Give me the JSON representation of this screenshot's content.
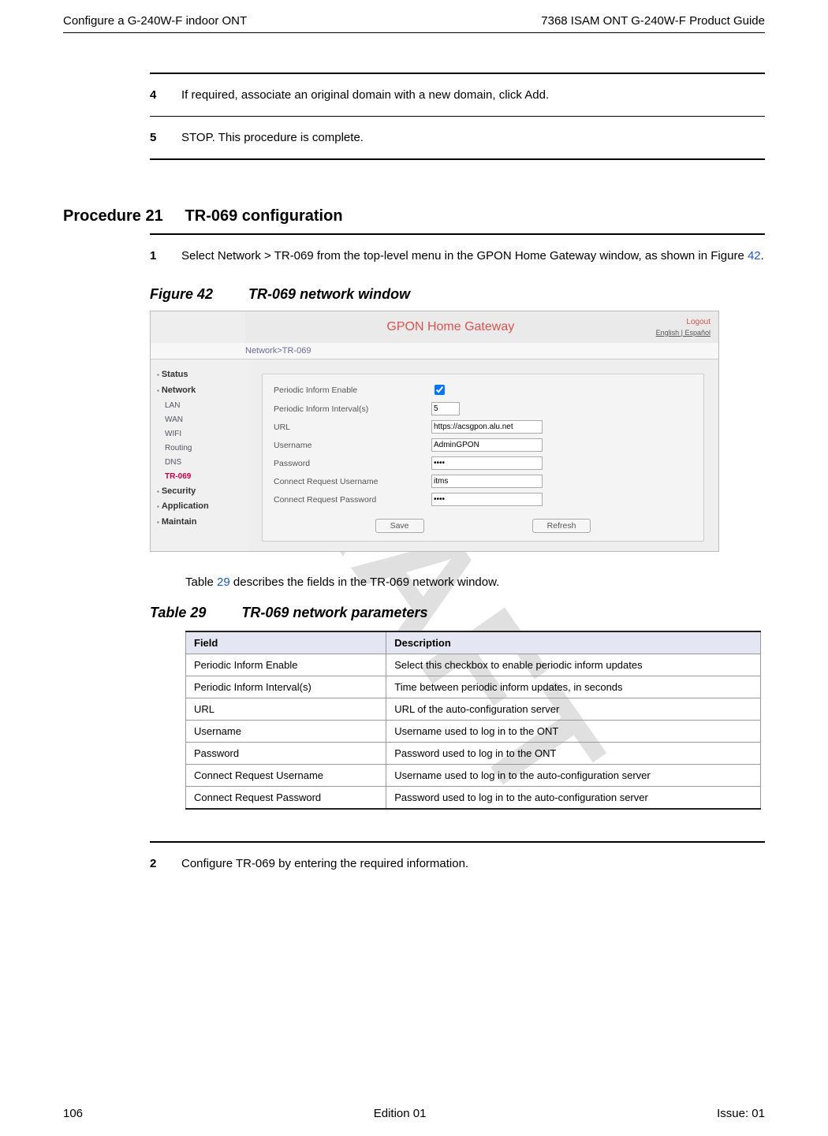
{
  "header": {
    "left": "Configure a G-240W-F indoor ONT",
    "right": "7368 ISAM ONT G-240W-F Product Guide"
  },
  "watermark": "DRAFT",
  "steps_top": [
    {
      "num": "4",
      "text": "If required, associate an original domain with a new domain, click Add."
    },
    {
      "num": "5",
      "text": "STOP. This procedure is complete."
    }
  ],
  "procedure": {
    "label": "Procedure 21",
    "title": "TR-069 configuration"
  },
  "step1": {
    "num": "1",
    "text_prefix": "Select Network > TR-069 from the top-level menu in the GPON Home Gateway window, as shown in Figure ",
    "link": "42",
    "text_suffix": "."
  },
  "figure": {
    "label": "Figure 42",
    "title": "TR-069 network window"
  },
  "screenshot": {
    "title": "GPON Home Gateway",
    "logout": "Logout",
    "lang": "English | Español",
    "breadcrumb": "Network>TR-069",
    "side": {
      "status": "Status",
      "network": "Network",
      "subs": [
        "LAN",
        "WAN",
        "WIFI",
        "Routing",
        "DNS",
        "TR-069"
      ],
      "security": "Security",
      "application": "Application",
      "maintain": "Maintain"
    },
    "rows": {
      "r1_label": "Periodic Inform Enable",
      "r2_label": "Periodic Inform Interval(s)",
      "r2_val": "5",
      "r3_label": "URL",
      "r3_val": "https://acsgpon.alu.net",
      "r4_label": "Username",
      "r4_val": "AdminGPON",
      "r5_label": "Password",
      "r5_val": "••••",
      "r6_label": "Connect Request Username",
      "r6_val": "itms",
      "r7_label": "Connect Request Password",
      "r7_val": "••••"
    },
    "buttons": {
      "save": "Save",
      "refresh": "Refresh"
    }
  },
  "table_intro_prefix": "Table ",
  "table_intro_link": "29",
  "table_intro_suffix": " describes the fields in the TR-069 network window.",
  "table": {
    "label": "Table 29",
    "title": "TR-069 network parameters",
    "col1": "Field",
    "col2": "Description",
    "rows": [
      {
        "f": "Periodic Inform Enable",
        "d": "Select this checkbox to enable periodic inform updates"
      },
      {
        "f": "Periodic Inform Interval(s)",
        "d": "Time between periodic inform updates, in seconds"
      },
      {
        "f": "URL",
        "d": "URL of the auto-configuration server"
      },
      {
        "f": "Username",
        "d": "Username used to log in to the ONT"
      },
      {
        "f": "Password",
        "d": "Password used to log in to the ONT"
      },
      {
        "f": "Connect Request Username",
        "d": "Username used to log in to the auto-configuration server"
      },
      {
        "f": "Connect Request Password",
        "d": "Password used to log in to the auto-configuration server"
      }
    ]
  },
  "step2": {
    "num": "2",
    "text": "Configure TR-069 by entering the required information."
  },
  "footer": {
    "left": "106",
    "center": "Edition 01",
    "right": "Issue: 01"
  }
}
